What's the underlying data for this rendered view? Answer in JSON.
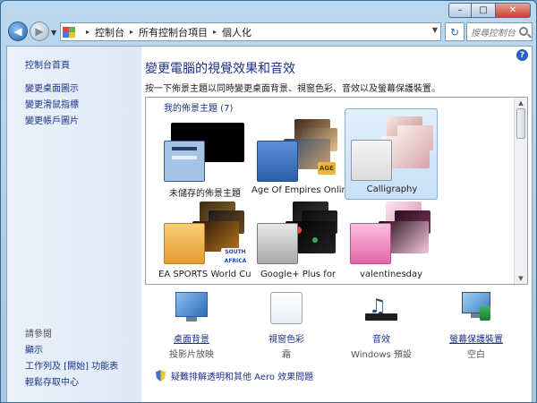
{
  "window": {
    "minimize_glyph": "–",
    "maximize_glyph": "□",
    "close_glyph": "✕"
  },
  "nav": {
    "back_glyph": "◀",
    "forward_glyph": "▶",
    "recent_glyph": "▼",
    "address_icon": "control-panel-icon",
    "breadcrumbs": [
      "控制台",
      "所有控制台項目",
      "個人化"
    ],
    "crumb_separator": "▸",
    "refresh_glyph": "↻",
    "search_placeholder": "搜尋控制台"
  },
  "sidebar": {
    "home": "控制台首頁",
    "links": [
      "變更桌面圖示",
      "變更滑鼠指標",
      "變更帳戶圖片"
    ],
    "see_also": "請參閱",
    "see_also_links": [
      "顯示",
      "工作列及 [開始] 功能表",
      "輕鬆存取中心"
    ]
  },
  "main": {
    "help_glyph": "?",
    "title": "變更電腦的視覺效果和音效",
    "subtitle": "按一下佈景主題以同時變更桌面背景、視窗色彩、音效以及螢幕保護裝置。",
    "group_label": "我的佈景主題 (7)",
    "themes": [
      {
        "label": "未儲存的佈景主題",
        "selected": false,
        "color": "#a6c3e6"
      },
      {
        "label": "Age Of Empires Online",
        "selected": false,
        "color": "#3f78c6"
      },
      {
        "label": "Calligraphy",
        "selected": true,
        "color": "#e9e5e2"
      },
      {
        "label": "EA SPORTS World Cup",
        "selected": false,
        "color": "#f2b64f"
      },
      {
        "label": "Google+ Plus for",
        "selected": false,
        "color": "#c9c9c9"
      },
      {
        "label": "valentinesday",
        "selected": false,
        "color": "#f29ad0"
      }
    ],
    "logos": {
      "aoe": "AGE",
      "south": "SOUTH",
      "africa": "AFRICA"
    },
    "scroll_up_glyph": "▲",
    "scroll_down_glyph": "▼",
    "bottom": [
      {
        "label": "桌面背景",
        "sub": "投影片放映",
        "link": true,
        "icon": "desktop-background-icon"
      },
      {
        "label": "視窗色彩",
        "sub": "霜",
        "link": false,
        "icon": "window-color-icon"
      },
      {
        "label": "音效",
        "sub": "Windows 預設",
        "link": false,
        "icon": "sound-icon"
      },
      {
        "label": "螢幕保護裝置",
        "sub": "空白",
        "link": true,
        "icon": "screensaver-icon"
      }
    ],
    "troubleshoot": "疑難排解透明和其他 Aero 效果問題"
  }
}
